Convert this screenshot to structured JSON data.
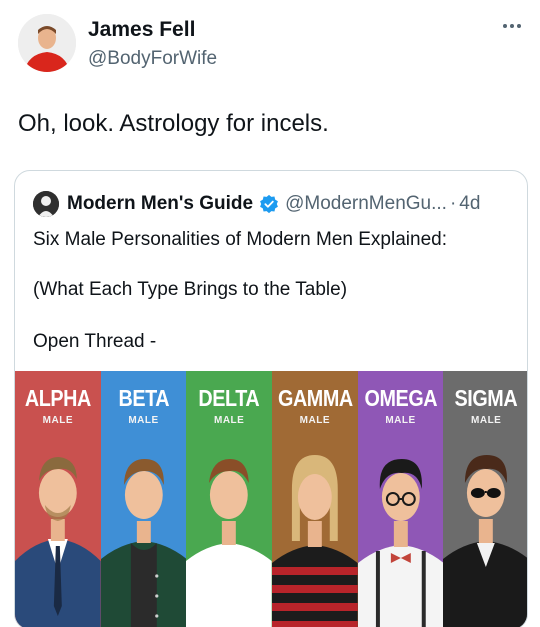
{
  "tweet": {
    "author_name": "James Fell",
    "author_handle": "@BodyForWife",
    "text": "Oh, look. Astrology for incels.",
    "more_icon": "more-horizontal-icon"
  },
  "quote": {
    "author_name": "Modern Men's Guide",
    "verified_icon": "verified-badge-icon",
    "handle": "@ModernMenGu...",
    "separator": "·",
    "time": "4d",
    "line1": "Six Male Personalities of Modern Men Explained:",
    "line2": "(What Each Type Brings to the Table)",
    "line3": "Open Thread -"
  },
  "banner": {
    "columns": [
      {
        "title": "ALPHA",
        "sub": "MALE",
        "bg": "#c9514f"
      },
      {
        "title": "BETA",
        "sub": "MALE",
        "bg": "#3f8fd6"
      },
      {
        "title": "DELTA",
        "sub": "MALE",
        "bg": "#4aa850"
      },
      {
        "title": "GAMMA",
        "sub": "MALE",
        "bg": "#a06a35"
      },
      {
        "title": "OMEGA",
        "sub": "MALE",
        "bg": "#8f57b6"
      },
      {
        "title": "SIGMA",
        "sub": "MALE",
        "bg": "#6c6c6c"
      }
    ]
  },
  "colors": {
    "text": "#0f1419",
    "muted": "#536471",
    "verified": "#1d9bf0",
    "border": "#cfd9de"
  }
}
